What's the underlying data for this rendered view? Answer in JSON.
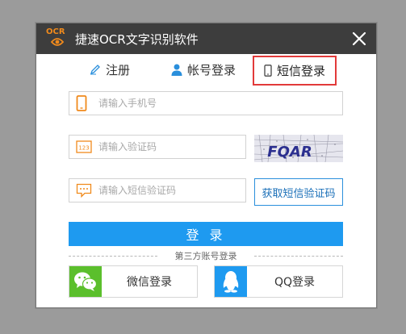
{
  "window": {
    "title": "捷速OCR文字识别软件",
    "logo_text": "OCR"
  },
  "tabs": [
    {
      "label": "注册",
      "icon": "pencil-icon",
      "active": false
    },
    {
      "label": "帐号登录",
      "icon": "user-icon",
      "active": false
    },
    {
      "label": "短信登录",
      "icon": "phone-icon",
      "active": true
    }
  ],
  "form": {
    "phone": {
      "placeholder": "请输入手机号",
      "value": ""
    },
    "captcha": {
      "placeholder": "请输入验证码",
      "value": "",
      "image_text": "FQAR"
    },
    "sms_code": {
      "placeholder": "请输入短信验证码",
      "value": ""
    },
    "get_sms_label": "获取短信验证码",
    "login_label": "登 录"
  },
  "third_party": {
    "divider_label": "第三方账号登录",
    "wechat_label": "微信登录",
    "qq_label": "QQ登录"
  },
  "colors": {
    "titlebar": "#3d3d3d",
    "accent": "#1e9af0",
    "orange": "#f08a1c",
    "active_tab_border": "#e23a3a",
    "wechat_green": "#5bbf2c",
    "qq_blue": "#1e9af0"
  }
}
